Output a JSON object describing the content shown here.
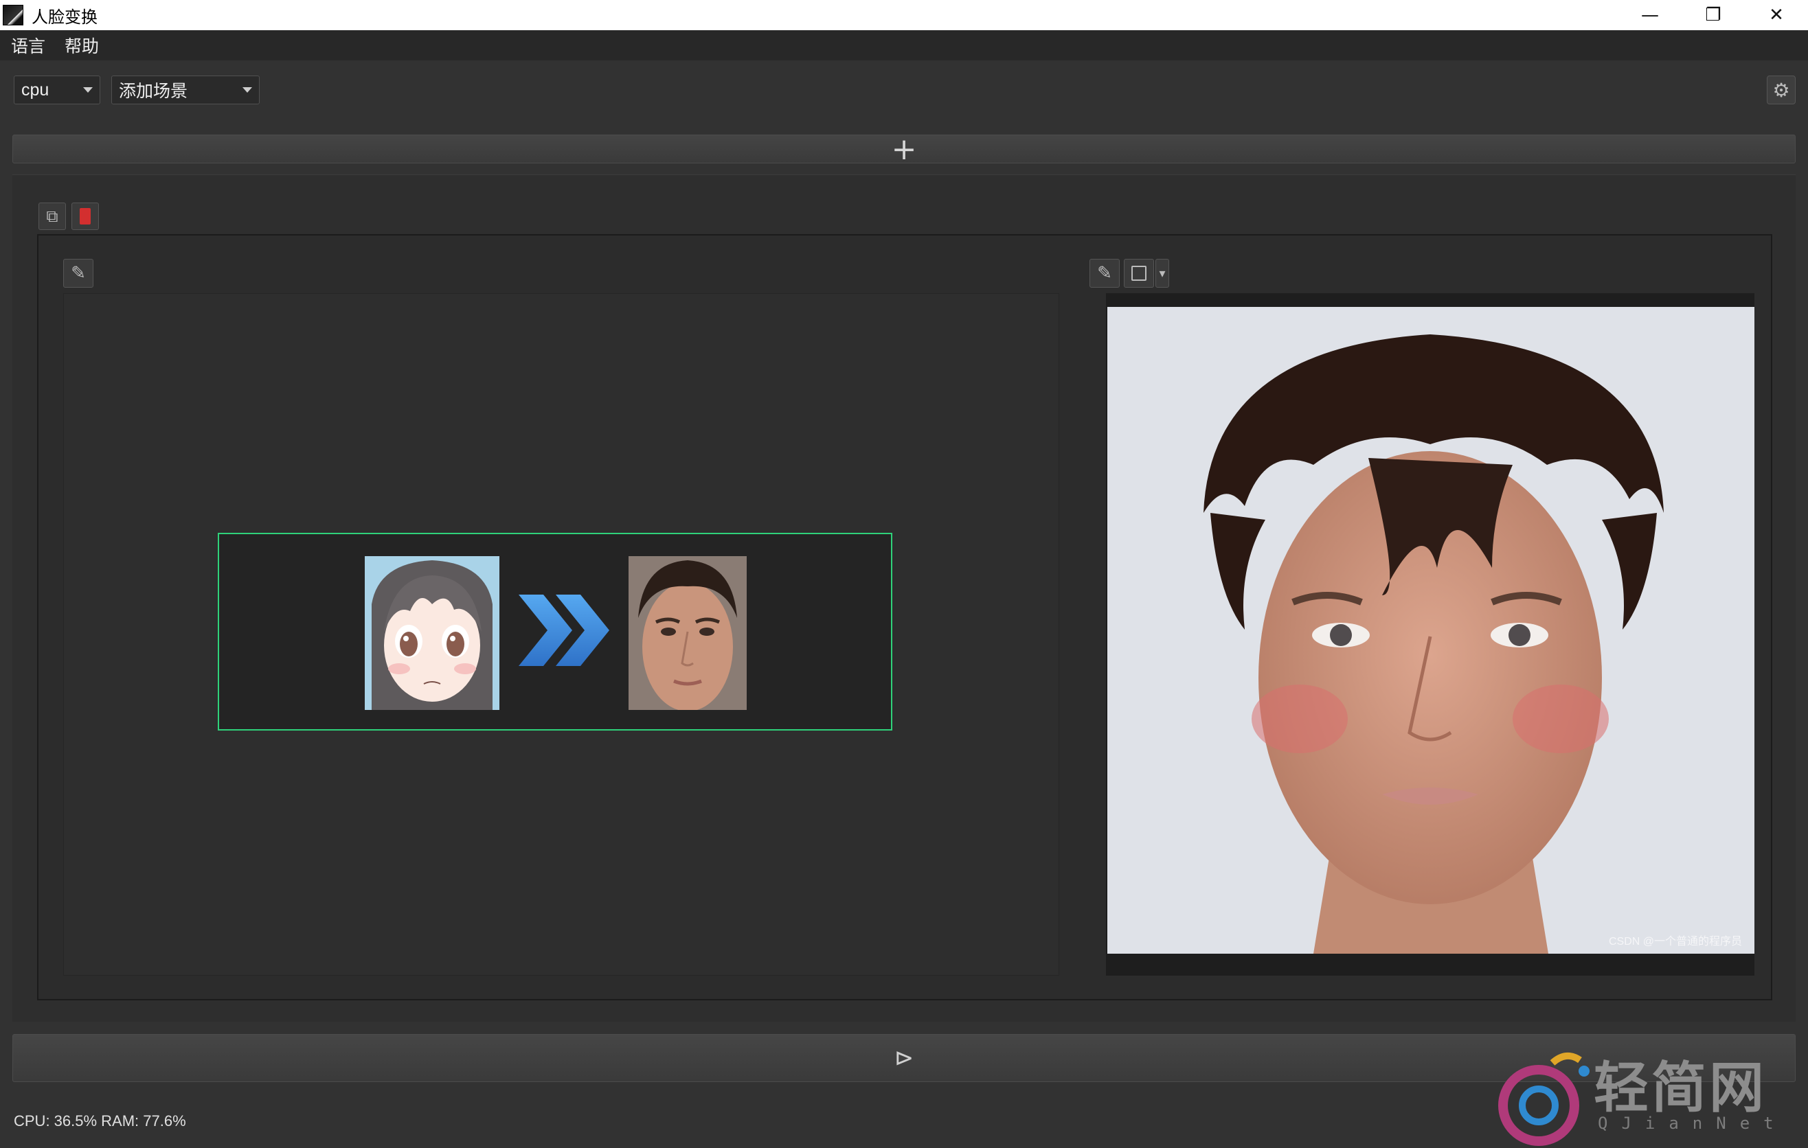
{
  "window": {
    "title": "人脸变换",
    "minimize_glyph": "—",
    "restore_glyph": "❐",
    "close_glyph": "✕"
  },
  "menu": {
    "items": [
      "语言",
      "帮助"
    ]
  },
  "toolbar": {
    "device_select": "cpu",
    "scene_select": "添加场景",
    "settings_icon": "gear-icon"
  },
  "add_bar": {
    "glyph": "+"
  },
  "scene": {
    "tools": {
      "duplicate_glyph": "⧉",
      "delete_glyph": "🗑"
    },
    "left_edit_glyph": "✎",
    "right_edit_glyph": "✎",
    "right_save_glyph": "💾",
    "right_dropdown_glyph": "▾",
    "result_watermark": "CSDN @一个普通的程序员"
  },
  "run_bar": {
    "glyph": "⊳"
  },
  "status": {
    "text": "CPU: 36.5%  RAM: 77.6%"
  },
  "watermark": {
    "brand": "轻简网",
    "sub": "QJianNet"
  },
  "colors": {
    "mapping_border": "#2fd27a",
    "delete_red": "#d32f2f",
    "arrow_blue": "#3f8fe0"
  }
}
